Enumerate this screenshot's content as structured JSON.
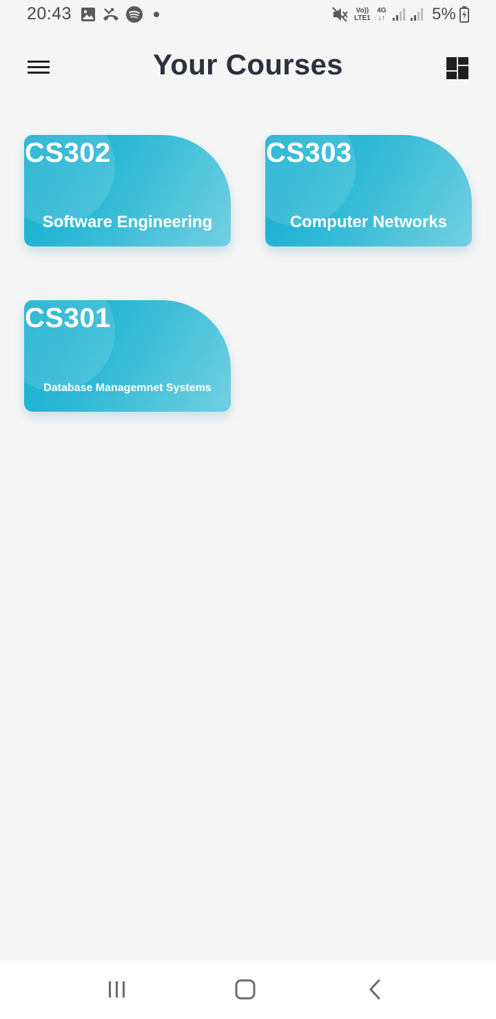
{
  "status_bar": {
    "time": "20:43",
    "battery_percent": "5%",
    "network_volte": "Vo))",
    "network_lte": "LTE1",
    "network_4g": "4G",
    "icons": [
      "gallery-icon",
      "missed-call-icon",
      "spotify-icon",
      "notification-dot-icon",
      "mute-icon",
      "signal-icon",
      "signal-icon",
      "battery-charging-icon"
    ]
  },
  "header": {
    "title": "Your Courses",
    "menu_icon": "hamburger-menu-icon",
    "layout_icon": "dashboard-icon"
  },
  "courses": [
    {
      "code": "CS302",
      "name": "Software Engineering"
    },
    {
      "code": "CS303",
      "name": "Computer Networks"
    },
    {
      "code": "CS301",
      "name": "Database Managemnet Systems"
    }
  ],
  "colors": {
    "background": "#f5f5f5",
    "card_gradient_start": "#11aed0",
    "card_gradient_end": "#73d0e2",
    "title_text": "#2c313c",
    "nav_bar": "#ffffff"
  },
  "nav_bar": {
    "icons": [
      "recent-apps-icon",
      "home-icon",
      "back-icon"
    ]
  }
}
